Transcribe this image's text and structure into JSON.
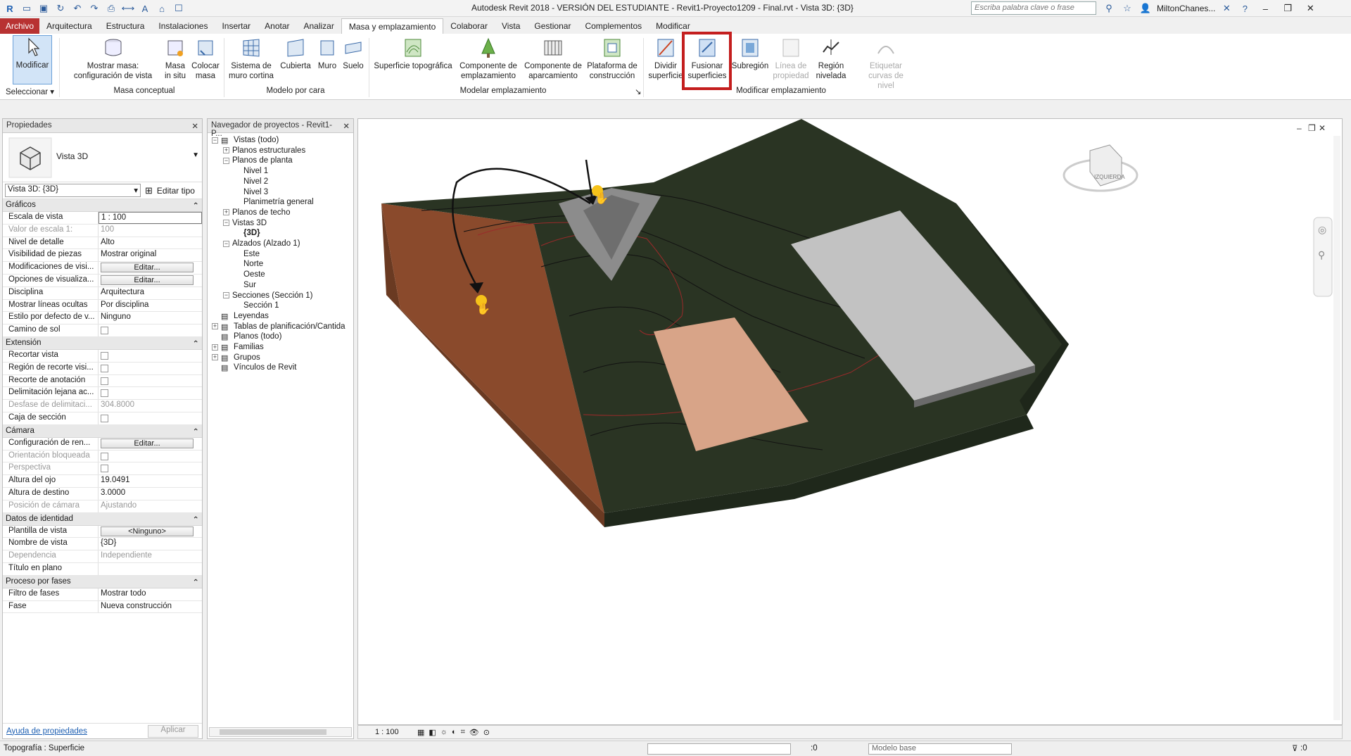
{
  "titlebar": {
    "title": "Autodesk Revit 2018 - VERSIÓN DEL ESTUDIANTE -     Revit1-Proyecto1209 - Final.rvt - Vista 3D: {3D}",
    "search_placeholder": "Escriba palabra clave o frase",
    "user": "MiltonChanes..."
  },
  "tabs": [
    "Archivo",
    "Arquitectura",
    "Estructura",
    "Instalaciones",
    "Insertar",
    "Anotar",
    "Analizar",
    "Masa y emplazamiento",
    "Colaborar",
    "Vista",
    "Gestionar",
    "Complementos",
    "Modificar"
  ],
  "ribbon": {
    "modify": "Modificar",
    "select_group": "Seleccionar",
    "show_mass": "Mostrar masa:\nconfiguración de vista",
    "mass_in_place": "Masa\nin situ",
    "place_mass": "Colocar\nmasa",
    "group_conceptual": "Masa conceptual",
    "curtain_system": "Sistema de\nmuro cortina",
    "roof": "Cubierta",
    "wall": "Muro",
    "floor": "Suelo",
    "group_face": "Modelo por cara",
    "toposurface": "Superficie topográfica",
    "site_component": "Componente de\nemplazamiento",
    "parking_component": "Componente de\naparcamiento",
    "building_pad": "Plataforma de\nconstrucción",
    "group_model_site": "Modelar emplazamiento",
    "split_surface": "Dividir\nsuperficie",
    "merge_surfaces": "Fusionar\nsuperficies",
    "subregion": "Subregión",
    "property_line": "Línea de\npropiedad",
    "graded_region": "Región\nnivelada",
    "label_contours": "Etiquetar\ncurvas de nivel",
    "group_modify_site": "Modificar emplazamiento"
  },
  "properties": {
    "title": "Propiedades",
    "type_name": "Vista 3D",
    "instance_select": "Vista 3D: {3D}",
    "edit_type": "Editar tipo",
    "sections": [
      {
        "name": "Gráficos",
        "rows": [
          {
            "k": "Escala de vista",
            "v": "1 : 100",
            "kind": "input"
          },
          {
            "k": "Valor de escala    1:",
            "v": "100",
            "kind": "dim"
          },
          {
            "k": "Nivel de detalle",
            "v": "Alto"
          },
          {
            "k": "Visibilidad de piezas",
            "v": "Mostrar original"
          },
          {
            "k": "Modificaciones de visi...",
            "v": "Editar...",
            "kind": "button"
          },
          {
            "k": "Opciones de visualiza...",
            "v": "Editar...",
            "kind": "button"
          },
          {
            "k": "Disciplina",
            "v": "Arquitectura"
          },
          {
            "k": "Mostrar líneas ocultas",
            "v": "Por disciplina"
          },
          {
            "k": "Estilo por defecto de v...",
            "v": "Ninguno"
          },
          {
            "k": "Camino de sol",
            "v": "",
            "kind": "check"
          }
        ]
      },
      {
        "name": "Extensión",
        "rows": [
          {
            "k": "Recortar vista",
            "v": "",
            "kind": "check"
          },
          {
            "k": "Región de recorte visi...",
            "v": "",
            "kind": "check"
          },
          {
            "k": "Recorte de anotación",
            "v": "",
            "kind": "check"
          },
          {
            "k": "Delimitación lejana ac...",
            "v": "",
            "kind": "check"
          },
          {
            "k": "Desfase de delimitaci...",
            "v": "304.8000",
            "kind": "dim"
          },
          {
            "k": "Caja de sección",
            "v": "",
            "kind": "check"
          }
        ]
      },
      {
        "name": "Cámara",
        "rows": [
          {
            "k": "Configuración de ren...",
            "v": "Editar...",
            "kind": "button"
          },
          {
            "k": "Orientación bloqueada",
            "v": "",
            "kind": "checkdim"
          },
          {
            "k": "Perspectiva",
            "v": "",
            "kind": "checkdim"
          },
          {
            "k": "Altura del ojo",
            "v": "19.0491"
          },
          {
            "k": "Altura de destino",
            "v": "3.0000"
          },
          {
            "k": "Posición de cámara",
            "v": "Ajustando",
            "kind": "dim"
          }
        ]
      },
      {
        "name": "Datos de identidad",
        "rows": [
          {
            "k": "Plantilla de vista",
            "v": "<Ninguno>",
            "kind": "button"
          },
          {
            "k": "Nombre de vista",
            "v": "{3D}"
          },
          {
            "k": "Dependencia",
            "v": "Independiente",
            "kind": "dim"
          },
          {
            "k": "Título en plano",
            "v": ""
          }
        ]
      },
      {
        "name": "Proceso por fases",
        "rows": [
          {
            "k": "Filtro de fases",
            "v": "Mostrar todo"
          },
          {
            "k": "Fase",
            "v": "Nueva construcción"
          }
        ]
      }
    ],
    "help_link": "Ayuda de propiedades",
    "apply": "Aplicar"
  },
  "browser": {
    "title": "Navegador de proyectos - Revit1-P...",
    "nodes": [
      {
        "label": "Vistas (todo)",
        "level": 0,
        "exp": "-",
        "icon": true
      },
      {
        "label": "Planos estructurales",
        "level": 1,
        "exp": "+"
      },
      {
        "label": "Planos de planta",
        "level": 1,
        "exp": "-"
      },
      {
        "label": "Nivel 1",
        "level": 2
      },
      {
        "label": "Nivel 2",
        "level": 2
      },
      {
        "label": "Nivel 3",
        "level": 2
      },
      {
        "label": "Planimetría general",
        "level": 2
      },
      {
        "label": "Planos de techo",
        "level": 1,
        "exp": "+"
      },
      {
        "label": "Vistas 3D",
        "level": 1,
        "exp": "-"
      },
      {
        "label": "{3D}",
        "level": 2,
        "bold": true
      },
      {
        "label": "Alzados (Alzado 1)",
        "level": 1,
        "exp": "-"
      },
      {
        "label": "Este",
        "level": 2
      },
      {
        "label": "Norte",
        "level": 2
      },
      {
        "label": "Oeste",
        "level": 2
      },
      {
        "label": "Sur",
        "level": 2
      },
      {
        "label": "Secciones (Sección 1)",
        "level": 1,
        "exp": "-"
      },
      {
        "label": "Sección 1",
        "level": 2
      },
      {
        "label": "Leyendas",
        "level": 0,
        "icon": true
      },
      {
        "label": "Tablas de planificación/Cantida",
        "level": 0,
        "exp": "+",
        "icon": true
      },
      {
        "label": "Planos (todo)",
        "level": 0,
        "icon": true
      },
      {
        "label": "Familias",
        "level": 0,
        "exp": "+",
        "icon": true
      },
      {
        "label": "Grupos",
        "level": 0,
        "exp": "+",
        "icon": true
      },
      {
        "label": "Vínculos de Revit",
        "level": 0,
        "icon": true
      }
    ]
  },
  "viewport": {
    "scale": "1 : 100",
    "viewcube_label": "IZQUIERDA"
  },
  "status": {
    "text": "Topografía : Superficie",
    "model": "Modelo base",
    "count": ":0"
  },
  "colors": {
    "terrain": "#2a3423",
    "clay": "#8a4a2c",
    "pad": "#d8a488",
    "building": "#c2c2c2",
    "highlight": "#c41e1e"
  }
}
